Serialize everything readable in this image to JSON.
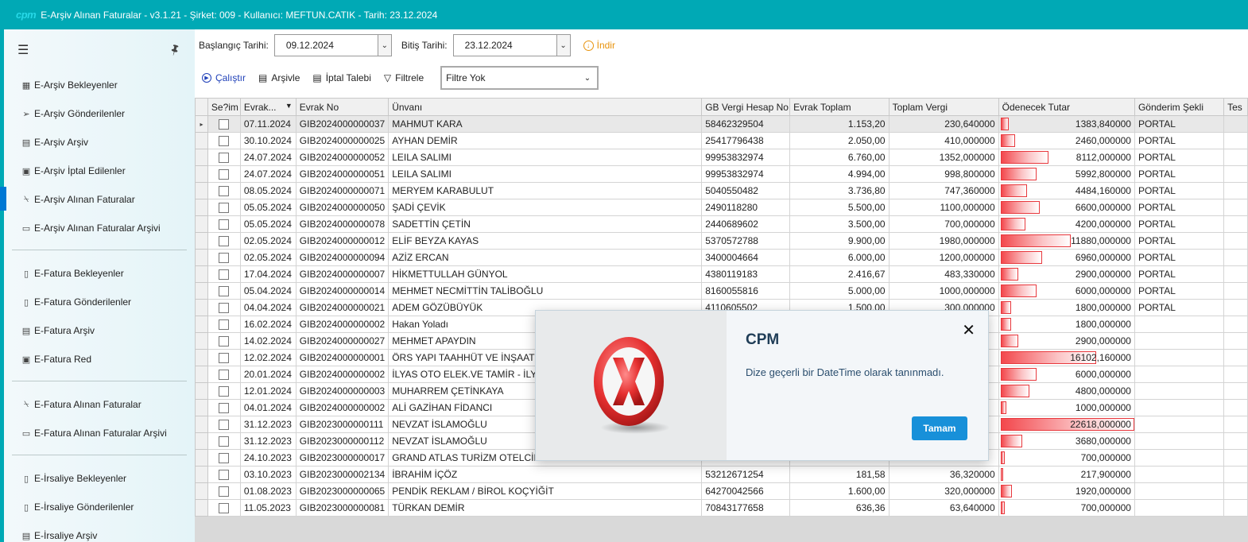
{
  "app": {
    "logo": "cpm",
    "title": "E-Arşiv Alınan Faturalar - v3.1.21 - Şirket: 009 - Kullanıcı: MEFTUN.CATIK - Tarih: 23.12.2024"
  },
  "sidebar": {
    "groups": [
      [
        {
          "label": "E-Arşiv Bekleyenler",
          "icon": "calculator-icon"
        },
        {
          "label": "E-Arşiv Gönderilenler",
          "icon": "send-icon"
        },
        {
          "label": "E-Arşiv Arşiv",
          "icon": "archive-icon"
        },
        {
          "label": "E-Arşiv İptal Edilenler",
          "icon": "cancel-doc-icon"
        },
        {
          "label": "E-Arşiv Alınan Faturalar",
          "icon": "inbox-icon",
          "active": true
        },
        {
          "label": "E-Arşiv Alınan Faturalar Arşivi",
          "icon": "folder-icon"
        }
      ],
      [
        {
          "label": "E-Fatura Bekleyenler",
          "icon": "document-icon"
        },
        {
          "label": "E-Fatura Gönderilenler",
          "icon": "document-icon"
        },
        {
          "label": "E-Fatura Arşiv",
          "icon": "archive-icon"
        },
        {
          "label": "E-Fatura Red",
          "icon": "cancel-doc-icon"
        }
      ],
      [
        {
          "label": "E-Fatura Alınan Faturalar",
          "icon": "inbox-icon"
        },
        {
          "label": "E-Fatura Alınan Faturalar Arşivi",
          "icon": "folder-icon"
        }
      ],
      [
        {
          "label": "E-İrsaliye Bekleyenler",
          "icon": "document-icon"
        },
        {
          "label": "E-İrsaliye Gönderilenler",
          "icon": "document-icon"
        },
        {
          "label": "E-İrsaliye Arşiv",
          "icon": "archive-icon"
        }
      ]
    ]
  },
  "filters": {
    "start_label": "Başlangıç Tarihi:",
    "start_value": "09.12.2024",
    "end_label": "Bitiş Tarihi:",
    "end_value": "23.12.2024",
    "download_label": "İndir"
  },
  "actions": {
    "run": "Çalıştır",
    "archive": "Arşivle",
    "cancel_request": "İptal Talebi",
    "filter": "Filtrele",
    "filter_select": "Filtre Yok"
  },
  "grid": {
    "columns": [
      "Se?im",
      "Evrak...",
      "Evrak No",
      "Ünvanı",
      "GB Vergi Hesap No",
      "Evrak Toplam",
      "Toplam Vergi",
      "Ödenecek Tutar",
      "Gönderim Şekli",
      "Tes"
    ],
    "rows": [
      {
        "date": "07.11.2024",
        "no": "GIB2024000000037",
        "name": "MAHMUT KARA",
        "tax": "58462329504",
        "total": "1.153,20",
        "vat": "230,640000",
        "pay": "1383,840000",
        "pay_value": 1383.84,
        "send": "PORTAL"
      },
      {
        "date": "30.10.2024",
        "no": "GIB2024000000025",
        "name": "AYHAN DEMİR",
        "tax": "25417796438",
        "total": "2.050,00",
        "vat": "410,000000",
        "pay": "2460,000000",
        "pay_value": 2460.0,
        "send": "PORTAL"
      },
      {
        "date": "24.07.2024",
        "no": "GIB2024000000052",
        "name": "LEILA SALIMI",
        "tax": "99953832974",
        "total": "6.760,00",
        "vat": "1352,000000",
        "pay": "8112,000000",
        "pay_value": 8112.0,
        "send": "PORTAL"
      },
      {
        "date": "24.07.2024",
        "no": "GIB2024000000051",
        "name": "LEILA SALIMI",
        "tax": "99953832974",
        "total": "4.994,00",
        "vat": "998,800000",
        "pay": "5992,800000",
        "pay_value": 5992.8,
        "send": "PORTAL"
      },
      {
        "date": "08.05.2024",
        "no": "GIB2024000000071",
        "name": "MERYEM KARABULUT",
        "tax": "5040550482",
        "total": "3.736,80",
        "vat": "747,360000",
        "pay": "4484,160000",
        "pay_value": 4484.16,
        "send": "PORTAL"
      },
      {
        "date": "05.05.2024",
        "no": "GIB2024000000050",
        "name": "ŞADİ ÇEVİK",
        "tax": "2490118280",
        "total": "5.500,00",
        "vat": "1100,000000",
        "pay": "6600,000000",
        "pay_value": 6600.0,
        "send": "PORTAL"
      },
      {
        "date": "05.05.2024",
        "no": "GIB2024000000078",
        "name": "SADETTİN ÇETİN",
        "tax": "2440689602",
        "total": "3.500,00",
        "vat": "700,000000",
        "pay": "4200,000000",
        "pay_value": 4200.0,
        "send": "PORTAL"
      },
      {
        "date": "02.05.2024",
        "no": "GIB2024000000012",
        "name": "ELİF BEYZA KAYAS",
        "tax": "5370572788",
        "total": "9.900,00",
        "vat": "1980,000000",
        "pay": "11880,000000",
        "pay_value": 11880.0,
        "send": "PORTAL"
      },
      {
        "date": "02.05.2024",
        "no": "GIB2024000000094",
        "name": "AZİZ ERCAN",
        "tax": "3400004664",
        "total": "6.000,00",
        "vat": "1200,000000",
        "pay": "6960,000000",
        "pay_value": 6960.0,
        "send": "PORTAL"
      },
      {
        "date": "17.04.2024",
        "no": "GIB2024000000007",
        "name": "HİKMETTULLAH GÜNYOL",
        "tax": "4380119183",
        "total": "2.416,67",
        "vat": "483,330000",
        "pay": "2900,000000",
        "pay_value": 2900.0,
        "send": "PORTAL"
      },
      {
        "date": "05.04.2024",
        "no": "GIB2024000000014",
        "name": "MEHMET NECMİTTİN TALİBOĞLU",
        "tax": "8160055816",
        "total": "5.000,00",
        "vat": "1000,000000",
        "pay": "6000,000000",
        "pay_value": 6000.0,
        "send": "PORTAL"
      },
      {
        "date": "04.04.2024",
        "no": "GIB2024000000021",
        "name": "ADEM GÖZÜBÜYÜK",
        "tax": "4110605502",
        "total": "1.500,00",
        "vat": "300,000000",
        "pay": "1800,000000",
        "pay_value": 1800.0,
        "send": "PORTAL"
      },
      {
        "date": "16.02.2024",
        "no": "GIB2024000000002",
        "name": "Hakan Yoladı",
        "tax": "",
        "total": "",
        "vat": "",
        "pay": "1800,000000",
        "pay_value": 1800.0,
        "send": ""
      },
      {
        "date": "14.02.2024",
        "no": "GIB2024000000027",
        "name": "MEHMET APAYDIN",
        "tax": "",
        "total": "",
        "vat": "",
        "pay": "2900,000000",
        "pay_value": 2900.0,
        "send": ""
      },
      {
        "date": "12.02.2024",
        "no": "GIB2024000000001",
        "name": "ÖRS YAPI TAAHHÜT VE İNŞAAT SA",
        "tax": "",
        "total": "",
        "vat": "",
        "pay": "16102,160000",
        "pay_value": 16102.16,
        "send": ""
      },
      {
        "date": "20.01.2024",
        "no": "GIB2024000000002",
        "name": "İLYAS OTO ELEK.VE TAMİR - İLYAS",
        "tax": "",
        "total": "",
        "vat": "",
        "pay": "6000,000000",
        "pay_value": 6000.0,
        "send": ""
      },
      {
        "date": "12.01.2024",
        "no": "GIB2024000000003",
        "name": "MUHARREM ÇETİNKAYA",
        "tax": "",
        "total": "",
        "vat": "",
        "pay": "4800,000000",
        "pay_value": 4800.0,
        "send": ""
      },
      {
        "date": "04.01.2024",
        "no": "GIB2024000000002",
        "name": "ALİ GAZİHAN FİDANCI",
        "tax": "",
        "total": "",
        "vat": "",
        "pay": "1000,000000",
        "pay_value": 1000.0,
        "send": ""
      },
      {
        "date": "31.12.2023",
        "no": "GIB2023000000111",
        "name": "NEVZAT İSLAMOĞLU",
        "tax": "",
        "total": "",
        "vat": "",
        "pay": "22618,000000",
        "pay_value": 22618.0,
        "send": ""
      },
      {
        "date": "31.12.2023",
        "no": "GIB2023000000112",
        "name": "NEVZAT İSLAMOĞLU",
        "tax": "",
        "total": "",
        "vat": "",
        "pay": "3680,000000",
        "pay_value": 3680.0,
        "send": ""
      },
      {
        "date": "24.10.2023",
        "no": "GIB2023000000017",
        "name": "GRAND ATLAS TURİZM OTELCİLİK",
        "tax": "",
        "total": "",
        "vat": "",
        "pay": "700,000000",
        "pay_value": 700.0,
        "send": ""
      },
      {
        "date": "03.10.2023",
        "no": "GIB2023000002134",
        "name": "İBRAHİM İÇÖZ",
        "tax": "53212671254",
        "total": "181,58",
        "vat": "36,320000",
        "pay": "217,900000",
        "pay_value": 217.9,
        "send": ""
      },
      {
        "date": "01.08.2023",
        "no": "GIB2023000000065",
        "name": "PENDİK REKLAM / BİROL KOÇYİĞİT",
        "tax": "64270042566",
        "total": "1.600,00",
        "vat": "320,000000",
        "pay": "1920,000000",
        "pay_value": 1920.0,
        "send": ""
      },
      {
        "date": "11.05.2023",
        "no": "GIB2023000000081",
        "name": "TÜRKAN DEMİR",
        "tax": "70843177658",
        "total": "636,36",
        "vat": "63,640000",
        "pay": "700,000000",
        "pay_value": 700.0,
        "send": ""
      }
    ],
    "bar_max": 22618.0
  },
  "dialog": {
    "title": "CPM",
    "message": "Dize geçerli bir DateTime olarak tanınmadı.",
    "ok_label": "Tamam",
    "icon": "error-x-icon"
  }
}
